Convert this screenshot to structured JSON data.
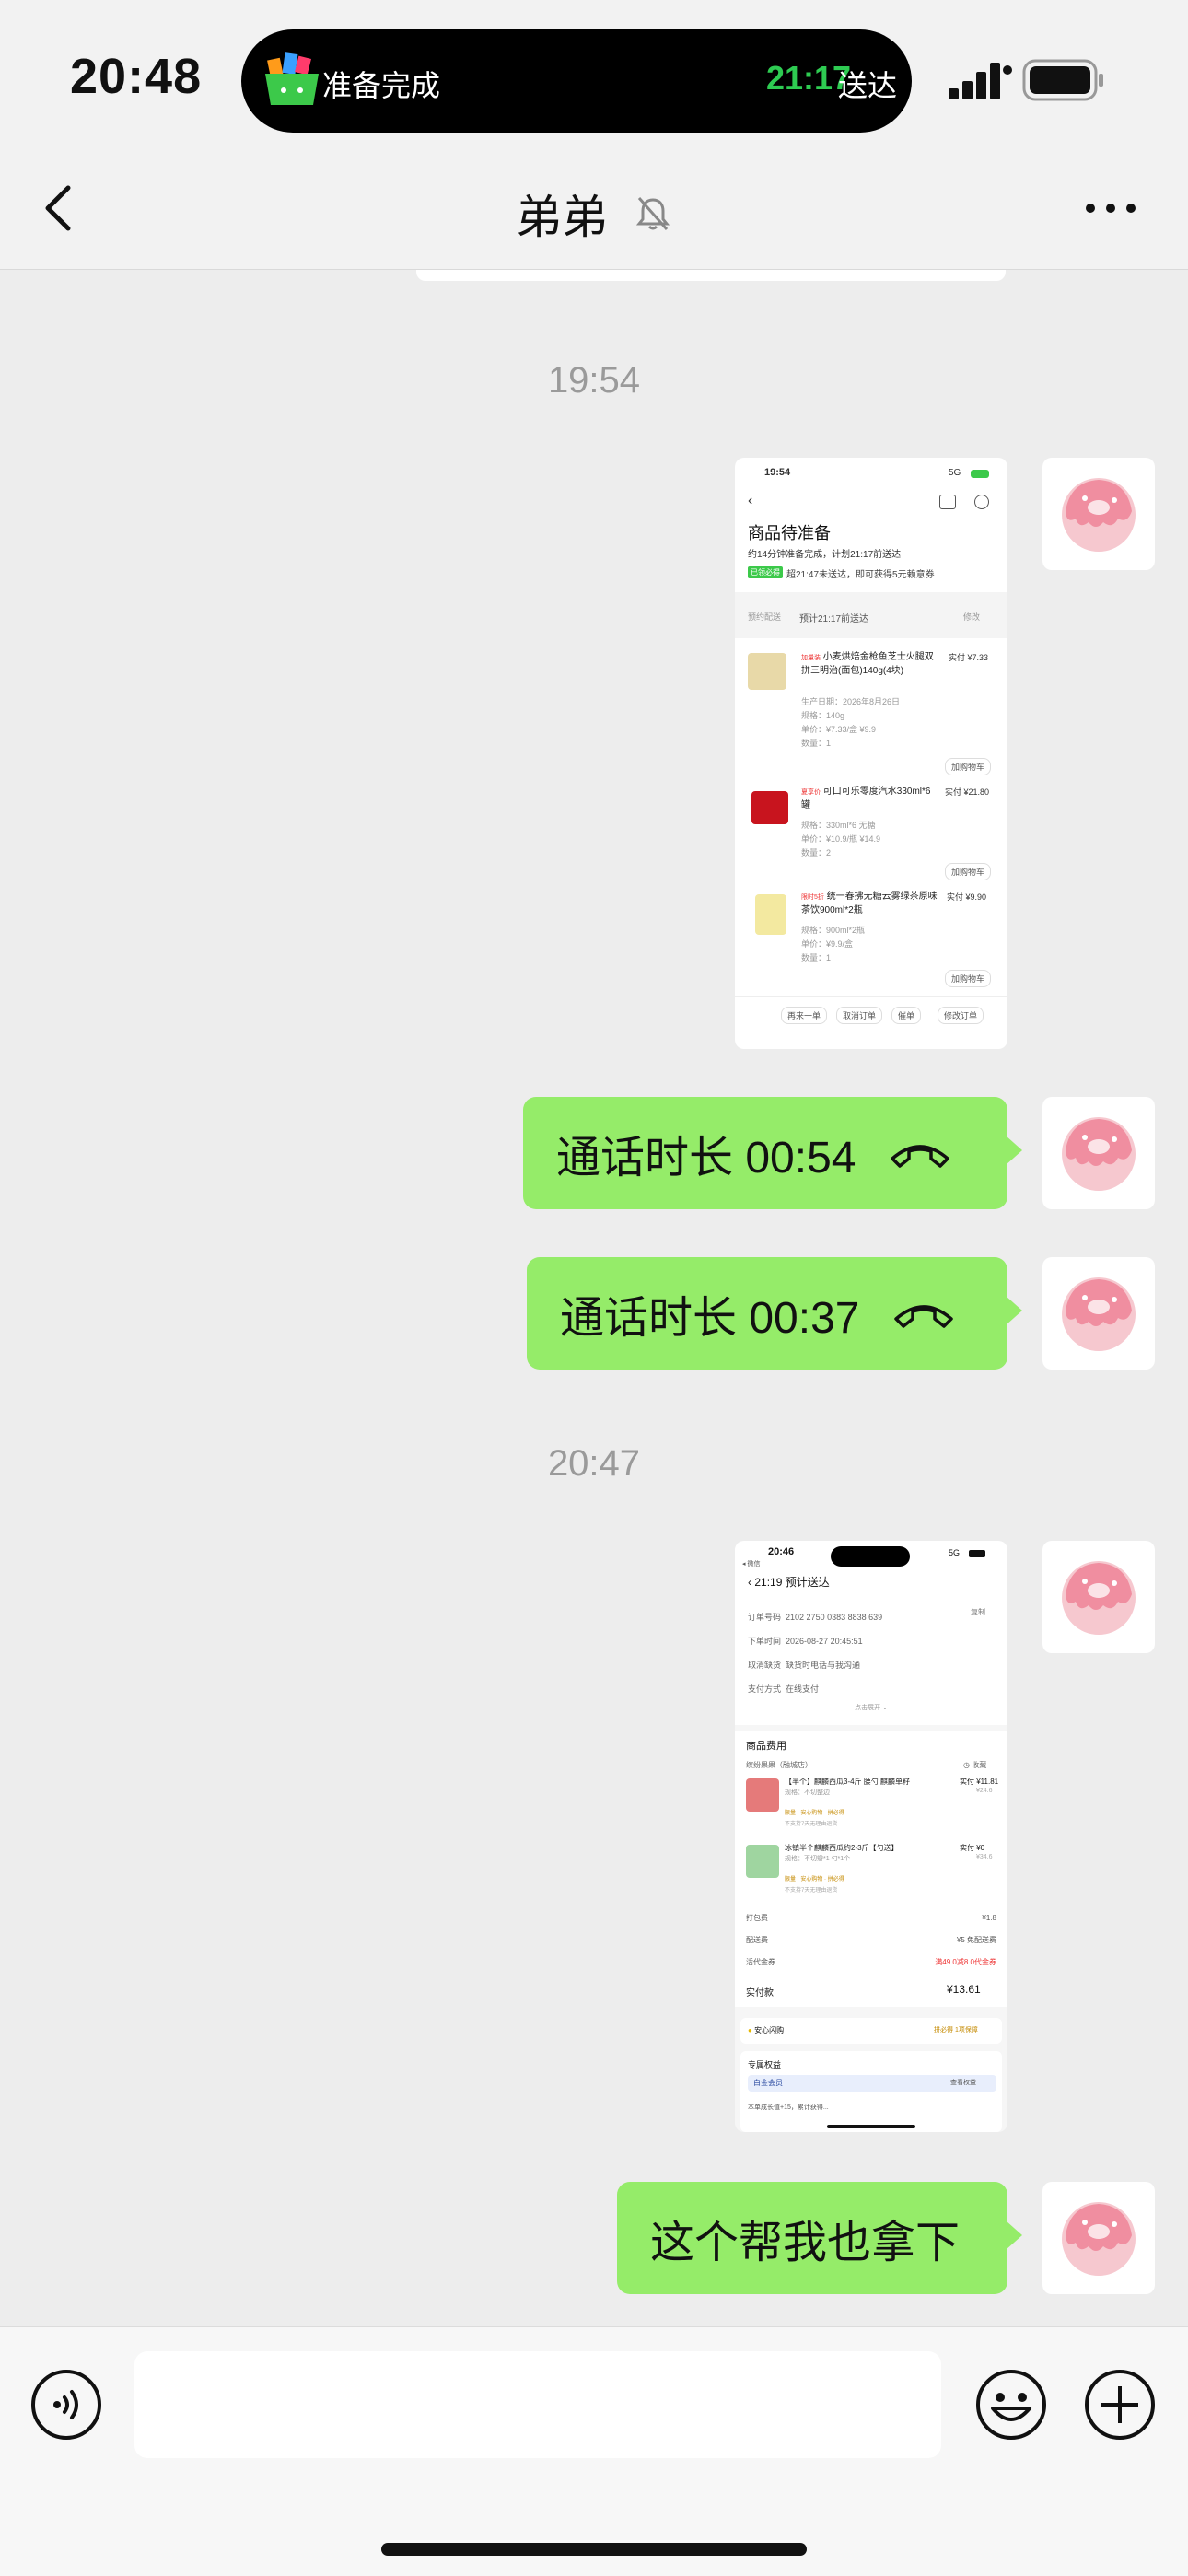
{
  "status_bar": {
    "time": "20:48",
    "island_text": "准备完成",
    "island_eta": "21:17",
    "island_eta_label": "送达",
    "icons": [
      "delivery-app-icon",
      "signal-icon",
      "battery-icon"
    ]
  },
  "nav": {
    "title": "弟弟",
    "icons": [
      "back-icon",
      "mute-bell-icon",
      "more-icon"
    ]
  },
  "messages": {
    "ts1": "19:54",
    "ts2": "20:47",
    "call1": "通话时长 00:54",
    "call2": "通话时长 00:37",
    "text1": "这个帮我也拿下"
  },
  "screenshot1": {
    "time": "19:54",
    "net": "5G",
    "title": "商品待准备",
    "subtitle": "约14分钟准备完成，计划21:17前送达",
    "badge": "已领必得",
    "coupon_text": "超21:47未送达，即可获得5元赖意券",
    "reserve_label": "预约配送",
    "reserve_value": "预计21:17前送达",
    "modify": "修改",
    "items": [
      {
        "tag": "加量装",
        "name": "小麦烘焙金枪鱼芝士火腿双拼三明治(面包)140g(4块)",
        "price": "实付 ¥7.33",
        "specs": [
          "生产日期：2026年8月26日",
          "规格：140g",
          "单价：¥7.33/盒 ¥9.9",
          "数量：1"
        ],
        "cart": "加购物车"
      },
      {
        "tag": "夏享价",
        "name": "可口可乐零度汽水330ml*6罐",
        "price": "实付 ¥21.80",
        "specs": [
          "规格：330ml*6 无糖",
          "单价：¥10.9/瓶 ¥14.9",
          "数量：2"
        ],
        "cart": "加购物车"
      },
      {
        "tag": "限时5折",
        "name": "统一春拂无糖云雾绿茶原味茶饮900ml*2瓶",
        "price": "实付 ¥9.90",
        "specs": [
          "规格：900ml*2瓶",
          "单价：¥9.9/盒",
          "数量：1"
        ],
        "cart": "加购物车"
      }
    ],
    "actions": [
      "再来一单",
      "取消订单",
      "催单",
      "修改订单"
    ]
  },
  "screenshot2": {
    "time": "20:46",
    "net": "5G",
    "back_label": "◂ 微信",
    "title": "21:19 预计送达",
    "rows": [
      {
        "label": "订单号码",
        "value": "2102 2750 0383 8838 639",
        "action": "复制"
      },
      {
        "label": "下单时间",
        "value": "2026-08-27 20:45:51",
        "action": ""
      },
      {
        "label": "取消缺货",
        "value": "缺货时电话与我沟通",
        "action": ""
      },
      {
        "label": "支付方式",
        "value": "在线支付",
        "action": ""
      }
    ],
    "expand": "点击展开 ⌄",
    "section_title": "商品费用",
    "store": "缤纷果果（融城店）",
    "collapse": "◷ 收藏",
    "items": [
      {
        "name": "【半个】麒麟西瓜3-4斤 腰勺 麒麟单籽",
        "sub": "规格：不切整边",
        "price": "实付 ¥11.81",
        "orig": "¥24.6",
        "tags": [
          "限量",
          "安心购物",
          "拼必得"
        ],
        "note": "不支持7天无理由退货"
      },
      {
        "name": "冰镇半个麒麟西瓜约2-3斤【勺送】",
        "sub": "规格：不切瓣*1 勺*1个",
        "price": "实付 ¥0",
        "orig": "¥34.6",
        "tags": [
          "限量",
          "安心购物",
          "拼必得"
        ],
        "note": "不支持7天无理由退货"
      }
    ],
    "fees": [
      {
        "label": "打包费",
        "value": "¥1.8"
      },
      {
        "label": "配送费",
        "value": "¥5 免配送费"
      },
      {
        "label": "活代金券",
        "value": "满49.0减8.0代金券"
      }
    ],
    "total_label": "实付款",
    "total_value": "¥13.61",
    "assure": "安心闪购",
    "assure_right": "拼必得 1项保障",
    "benefits": "专属权益",
    "member": "白金会员",
    "member_right": "查看权益",
    "footer": "本单成长值+15，累计获得..."
  },
  "input_bar": {
    "placeholder": "",
    "icons": [
      "voice-icon",
      "emoji-icon",
      "plus-icon"
    ]
  },
  "colors": {
    "bubble_green": "#95ec69",
    "chat_bg": "#ededed",
    "eta_green": "#2ecb52"
  }
}
